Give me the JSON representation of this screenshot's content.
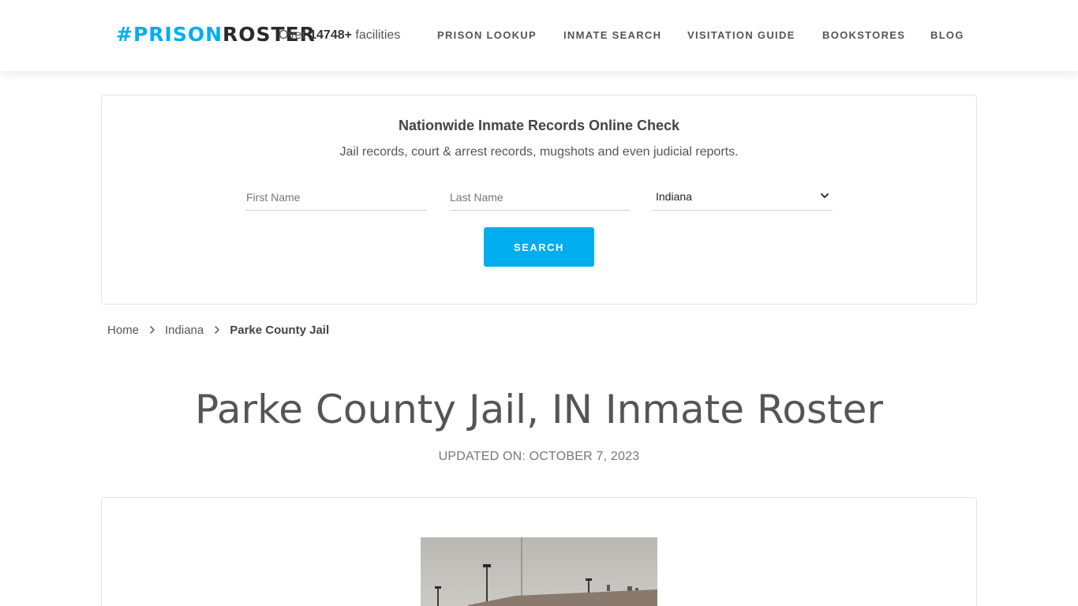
{
  "header": {
    "logo": {
      "hash": "#",
      "prison": "PRISON",
      "roster": "ROSTER"
    },
    "facilities": {
      "prefix": "Over",
      "count": "14748+",
      "suffix": "facilities"
    },
    "nav": [
      {
        "label": "PRISON LOOKUP"
      },
      {
        "label": "INMATE SEARCH"
      },
      {
        "label": "VISITATION GUIDE"
      },
      {
        "label": "BOOKSTORES"
      },
      {
        "label": "BLOG"
      }
    ]
  },
  "search": {
    "title": "Nationwide Inmate Records Online Check",
    "subtitle": "Jail records, court & arrest records, mugshots and even judicial reports.",
    "first_name_placeholder": "First Name",
    "last_name_placeholder": "Last Name",
    "state_selected": "Indiana",
    "button_label": "SEARCH"
  },
  "breadcrumb": {
    "home": "Home",
    "state": "Indiana",
    "current": "Parke County Jail"
  },
  "page": {
    "title": "Parke County Jail, IN Inmate Roster",
    "updated": "UPDATED ON: OCTOBER 7, 2023"
  },
  "colors": {
    "accent": "#00aeef",
    "text": "#555555",
    "border": "#e4e4e4"
  }
}
